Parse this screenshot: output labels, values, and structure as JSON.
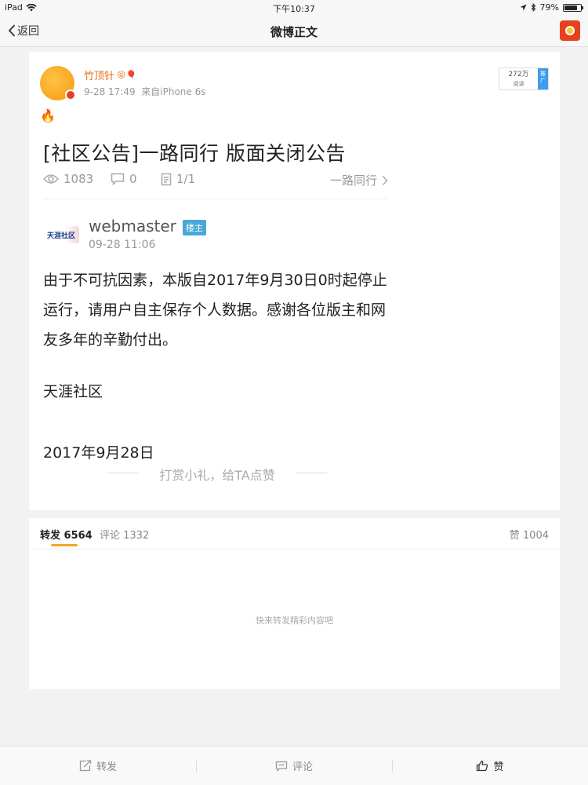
{
  "status_bar": {
    "device": "iPad",
    "time": "下午10:37",
    "battery": "79%",
    "battery_level": 0.79
  },
  "nav": {
    "back_label": "返回",
    "title": "微博正文"
  },
  "post": {
    "username": "竹顶针",
    "username_emoji": "😝🎈",
    "timestamp": "9-28 17:49",
    "source": "来自iPhone 6s",
    "read_count": "272万",
    "read_label": "阅读",
    "promo_label": "推广",
    "fire_emoji": "🔥",
    "screenshot": {
      "headline": "[社区公告]一路同行 版面关闭公告",
      "views": "1083",
      "comments": "0",
      "pages": "1/1",
      "board": "一路同行",
      "author_logo": "天涯社区",
      "author": "webmaster",
      "author_badge": "楼主",
      "author_time": "09-28 11:06",
      "body": "由于不可抗因素，本版自2017年9月30日0时起停止运行，请用户自主保存个人数据。感谢各位版主和网友多年的辛勤付出。",
      "signature": "天涯社区",
      "date": "2017年9月28日",
      "reward": "打赏小礼，给TA点赞"
    }
  },
  "tabs": {
    "repost_label": "转发",
    "repost_count": "6564",
    "comment_label": "评论",
    "comment_count": "1332",
    "like_label": "赞",
    "like_count": "1004"
  },
  "empty_hint": "快来转发精彩内容吧",
  "toolbar": {
    "repost": "转发",
    "comment": "评论",
    "like": "赞"
  }
}
